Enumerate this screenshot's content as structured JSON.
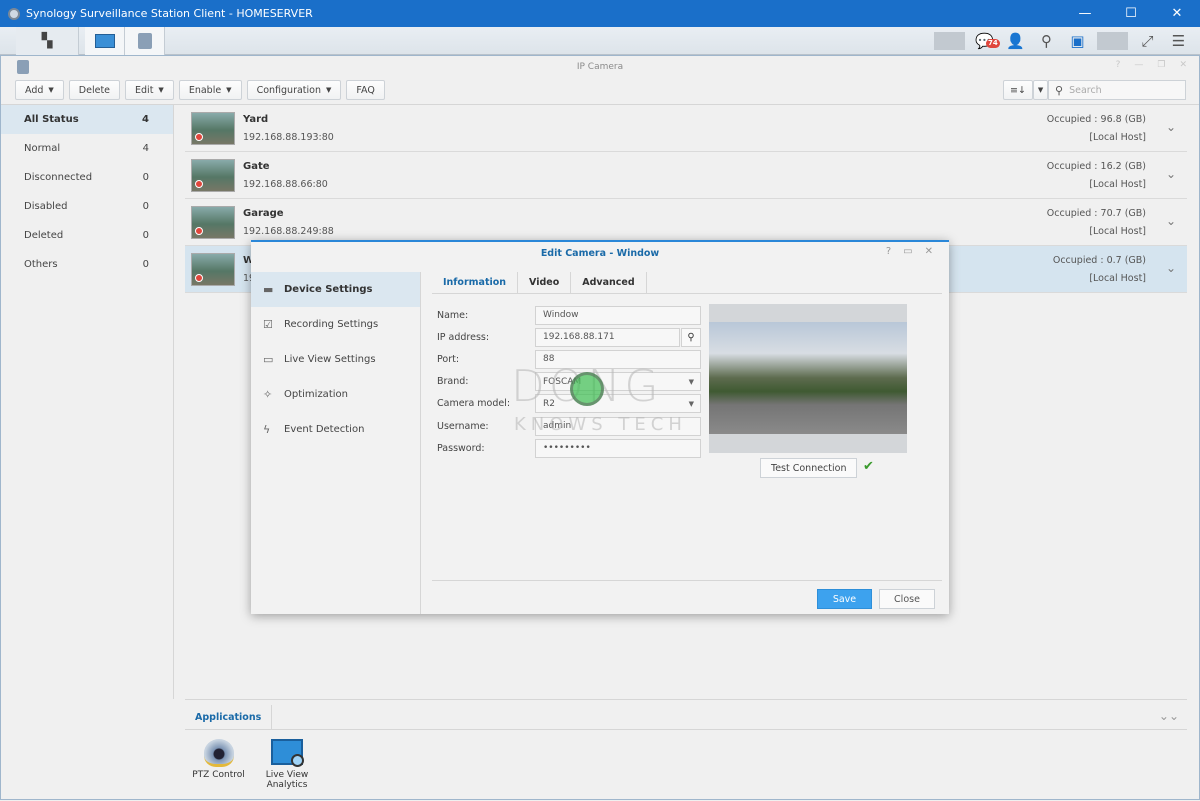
{
  "titlebar": {
    "title": "Synology Surveillance Station Client - HOMESERVER",
    "minimize": "—",
    "maximize": "☐",
    "close": "✕"
  },
  "appbar": {
    "notification_count": "74"
  },
  "window": {
    "title": "IP Camera",
    "help": "?",
    "minimize": "—",
    "restore": "❐",
    "close": "✕"
  },
  "toolbar": {
    "add": "Add",
    "delete": "Delete",
    "edit": "Edit",
    "enable": "Enable",
    "configuration": "Configuration",
    "faq": "FAQ"
  },
  "search": {
    "placeholder": "Search"
  },
  "sidebar": {
    "items": [
      {
        "label": "All Status",
        "count": "4"
      },
      {
        "label": "Normal",
        "count": "4"
      },
      {
        "label": "Disconnected",
        "count": "0"
      },
      {
        "label": "Disabled",
        "count": "0"
      },
      {
        "label": "Deleted",
        "count": "0"
      },
      {
        "label": "Others",
        "count": "0"
      }
    ]
  },
  "cameras": [
    {
      "name": "Yard",
      "ip": "192.168.88.193:80",
      "occupied": "Occupied : 96.8 (GB)",
      "host": "[Local Host]"
    },
    {
      "name": "Gate",
      "ip": "192.168.88.66:80",
      "occupied": "Occupied : 16.2 (GB)",
      "host": "[Local Host]"
    },
    {
      "name": "Garage",
      "ip": "192.168.88.249:88",
      "occupied": "Occupied : 70.7 (GB)",
      "host": "[Local Host]"
    },
    {
      "name": "Window",
      "ip": "192.168.88.171:88",
      "occupied": "Occupied : 0.7 (GB)",
      "host": "[Local Host]"
    }
  ],
  "applications": {
    "tab": "Applications",
    "items": [
      {
        "label": "PTZ Control"
      },
      {
        "label": "Live View Analytics"
      }
    ]
  },
  "dialog": {
    "title": "Edit Camera - Window",
    "nav": [
      "Device Settings",
      "Recording Settings",
      "Live View Settings",
      "Optimization",
      "Event Detection"
    ],
    "tabs": [
      "Information",
      "Video",
      "Advanced"
    ],
    "fields": {
      "name": {
        "label": "Name:",
        "value": "Window"
      },
      "ip": {
        "label": "IP address:",
        "value": "192.168.88.171"
      },
      "port": {
        "label": "Port:",
        "value": "88"
      },
      "brand": {
        "label": "Brand:",
        "value": "FOSCAM"
      },
      "model": {
        "label": "Camera model:",
        "value": "R2"
      },
      "username": {
        "label": "Username:",
        "value": "admin"
      },
      "password": {
        "label": "Password:",
        "value": "•••••••••"
      }
    },
    "test_connection": "Test Connection",
    "save": "Save",
    "close": "Close"
  },
  "watermark": {
    "line1": "DONG",
    "line2": "KNOWS TECH"
  }
}
